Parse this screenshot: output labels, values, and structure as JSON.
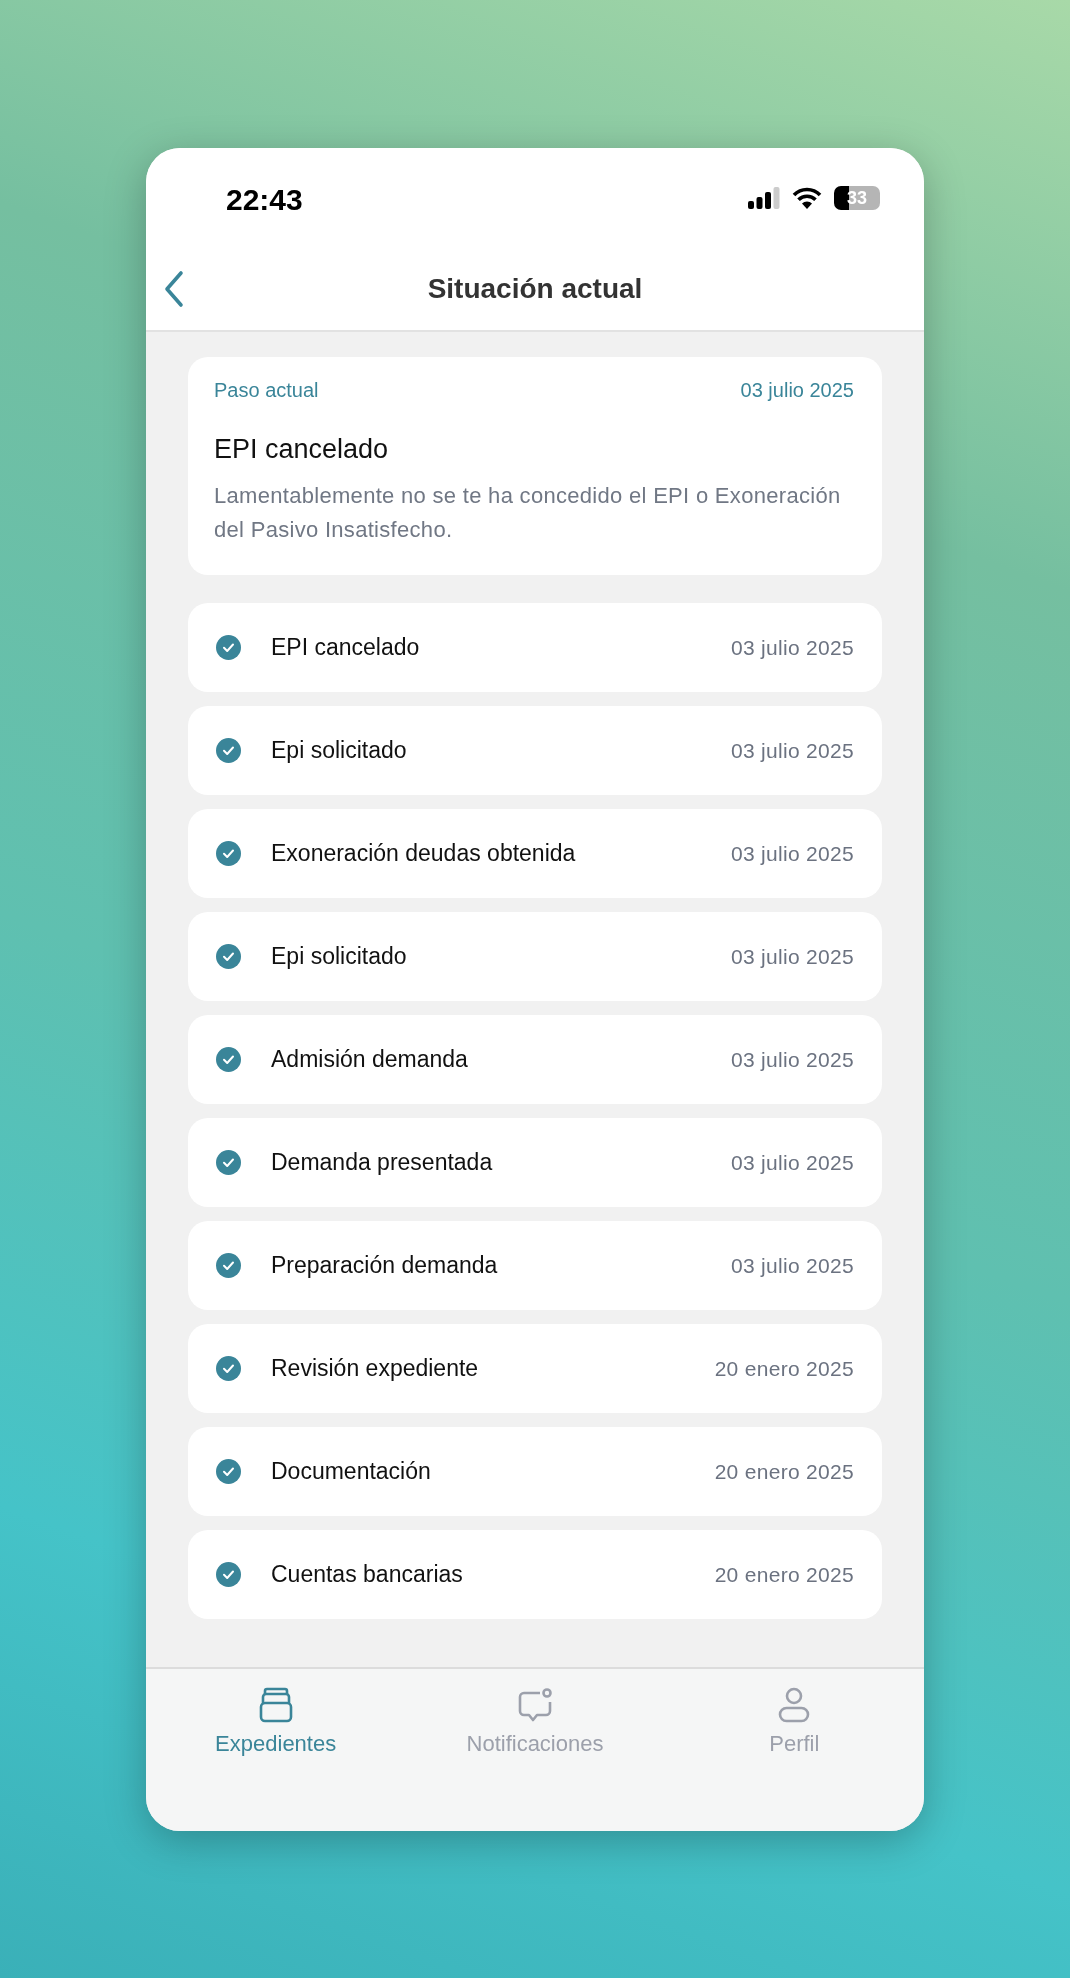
{
  "status_bar": {
    "time": "22:43",
    "battery": "33"
  },
  "header": {
    "title": "Situación actual"
  },
  "current_step": {
    "label": "Paso actual",
    "date": "03 julio 2025",
    "title": "EPI cancelado",
    "description": "Lamentablemente no se te ha concedido el EPI o Exoneración del Pasivo Insatisfecho."
  },
  "steps": [
    {
      "name": "EPI cancelado",
      "date": "03 julio 2025",
      "done": true
    },
    {
      "name": "Epi solicitado",
      "date": "03 julio 2025",
      "done": true
    },
    {
      "name": "Exoneración deudas obtenida",
      "date": "03 julio 2025",
      "done": true
    },
    {
      "name": "Epi solicitado",
      "date": "03 julio 2025",
      "done": true
    },
    {
      "name": "Admisión demanda",
      "date": "03 julio 2025",
      "done": true
    },
    {
      "name": "Demanda presentada",
      "date": "03 julio 2025",
      "done": true
    },
    {
      "name": "Preparación demanda",
      "date": "03 julio 2025",
      "done": true
    },
    {
      "name": "Revisión expediente",
      "date": "20 enero 2025",
      "done": true
    },
    {
      "name": "Documentación",
      "date": "20 enero 2025",
      "done": true
    },
    {
      "name": "Cuentas bancarias",
      "date": "20 enero 2025",
      "done": true
    }
  ],
  "tab_bar": [
    {
      "label": "Expedientes",
      "kind": "files",
      "selected": true
    },
    {
      "label": "Notificaciones",
      "kind": "chat",
      "selected": false
    },
    {
      "label": "Perfil",
      "kind": "user",
      "selected": false
    }
  ]
}
